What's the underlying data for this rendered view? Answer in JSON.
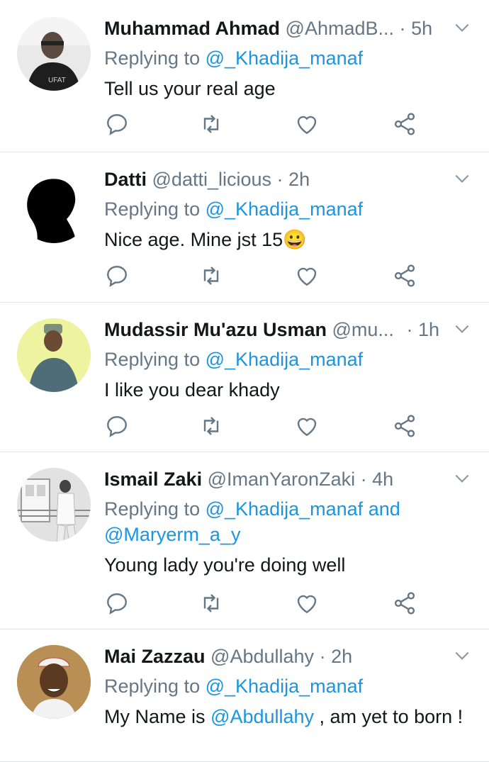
{
  "tweets": [
    {
      "name": "Muhammad Ahmad",
      "handle": "@AhmadB...",
      "time": "5h",
      "replying_label": "Replying to",
      "replying_to": "@_Khadija_manaf",
      "replying_and": "",
      "replying_to2": "",
      "text_parts": [
        "Tell us your real age"
      ],
      "avatar_icon": "man-in-black-shirt-avatar"
    },
    {
      "name": "Datti",
      "handle": "@datti_licious",
      "time": "2h",
      "replying_label": "Replying to",
      "replying_to": "@_Khadija_manaf",
      "replying_and": "",
      "replying_to2": "",
      "text_parts": [
        "Nice age. Mine jst 15",
        "😀"
      ],
      "avatar_icon": "silhouette-avatar"
    },
    {
      "name": "Mudassir Mu'azu Usman",
      "handle": "@mu...",
      "time": "1h",
      "replying_label": "Replying to",
      "replying_to": "@_Khadija_manaf",
      "replying_and": "",
      "replying_to2": "",
      "text_parts": [
        "I like you dear khady"
      ],
      "avatar_icon": "man-on-yellow-avatar"
    },
    {
      "name": "Ismail Zaki",
      "handle": "@ImanYaronZaki",
      "time": "4h",
      "replying_label": "Replying to",
      "replying_to": "@_Khadija_manaf",
      "replying_and": "and",
      "replying_to2": "@Maryerm_a_y",
      "text_parts": [
        "Young lady you're doing well"
      ],
      "avatar_icon": "grayscale-building-avatar"
    },
    {
      "name": "Mai Zazzau",
      "handle": "@Abdullahy",
      "time": "2h",
      "replying_label": "Replying to",
      "replying_to": "@_Khadija_manaf",
      "replying_and": "",
      "replying_to2": "",
      "text_parts": [
        "My Name is ",
        "@Abdullahy",
        " , am yet to born !"
      ],
      "avatar_icon": "smiling-man-cap-avatar"
    }
  ],
  "action_icons": [
    "reply-icon",
    "retweet-icon",
    "like-icon",
    "share-icon"
  ],
  "colors": {
    "link": "#1b95e0",
    "secondary": "#657786",
    "primary_text": "#14171a",
    "divider": "#dfe3e8"
  }
}
